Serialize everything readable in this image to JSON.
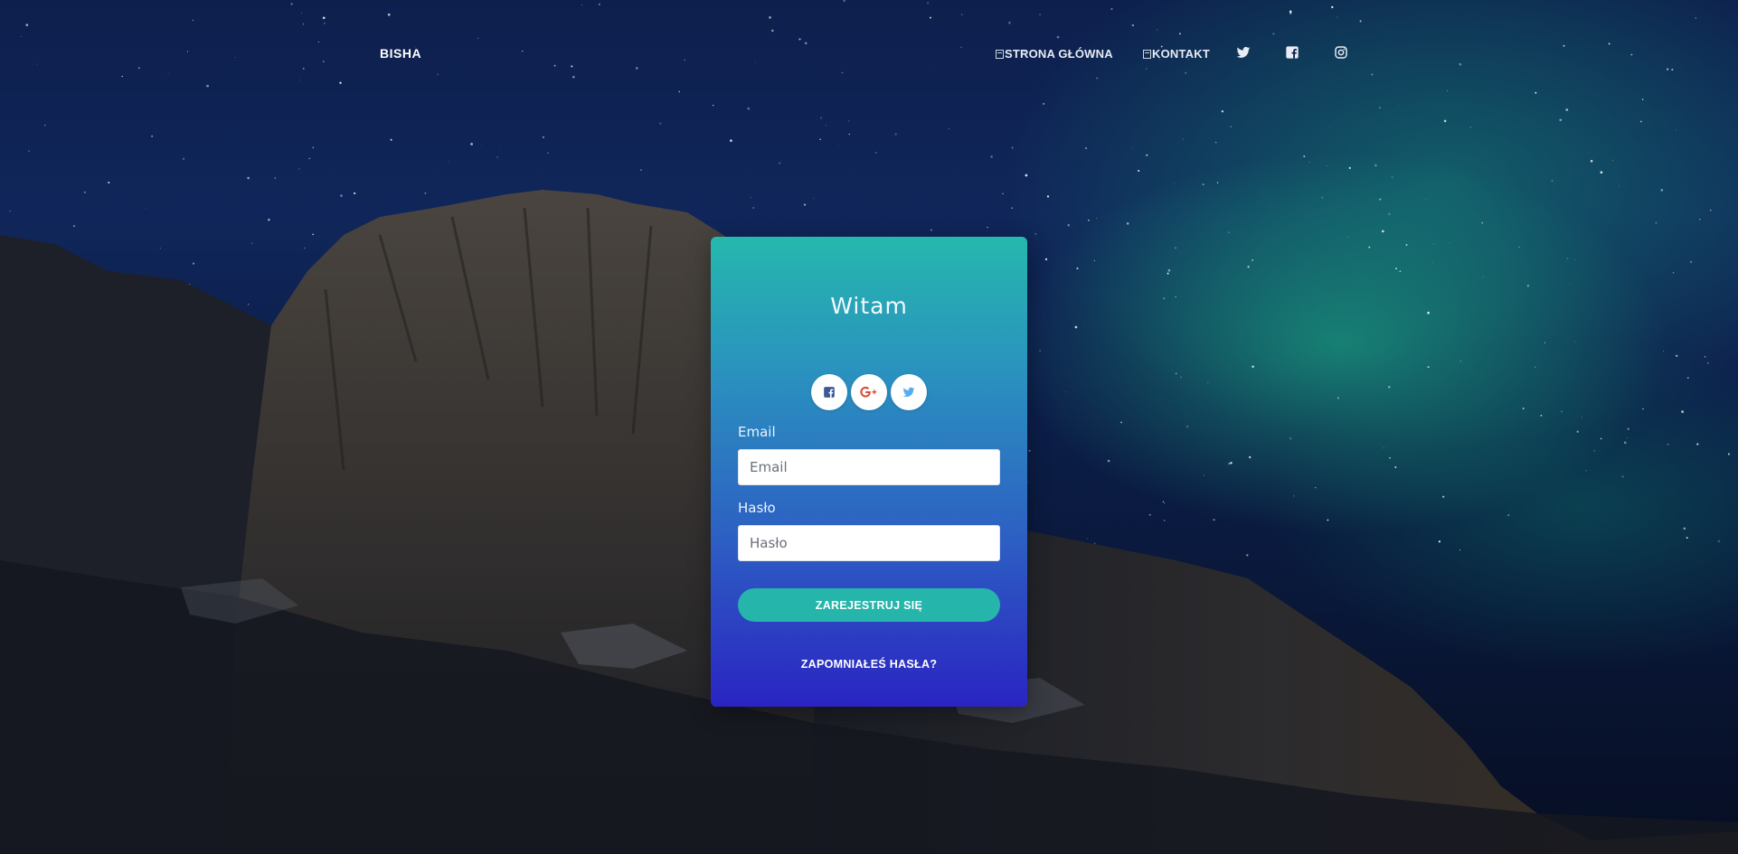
{
  "nav": {
    "brand": "BISHA",
    "links": [
      {
        "label": "STRONA GŁÓWNA",
        "icon": "home-icon"
      },
      {
        "label": "KONTAKT",
        "icon": "contact-icon"
      }
    ],
    "social_icons": [
      "twitter-icon",
      "facebook-icon",
      "instagram-icon"
    ]
  },
  "card": {
    "title": "Witam",
    "social_buttons": [
      "facebook-icon",
      "google-plus-icon",
      "twitter-icon"
    ],
    "email_label": "Email",
    "email_placeholder": "Email",
    "password_label": "Hasło",
    "password_placeholder": "Hasło",
    "submit_label": "ZAREJESTRUJ SIĘ",
    "forgot_label": "ZAPOMNIAŁEŚ HASŁA?"
  },
  "colors": {
    "card_gradient_top": "#25b8ae",
    "card_gradient_bottom": "#2a24c2",
    "submit_button": "#26b5aa",
    "facebook": "#3b5998",
    "google_plus": "#dd4b39",
    "twitter": "#55acee"
  }
}
